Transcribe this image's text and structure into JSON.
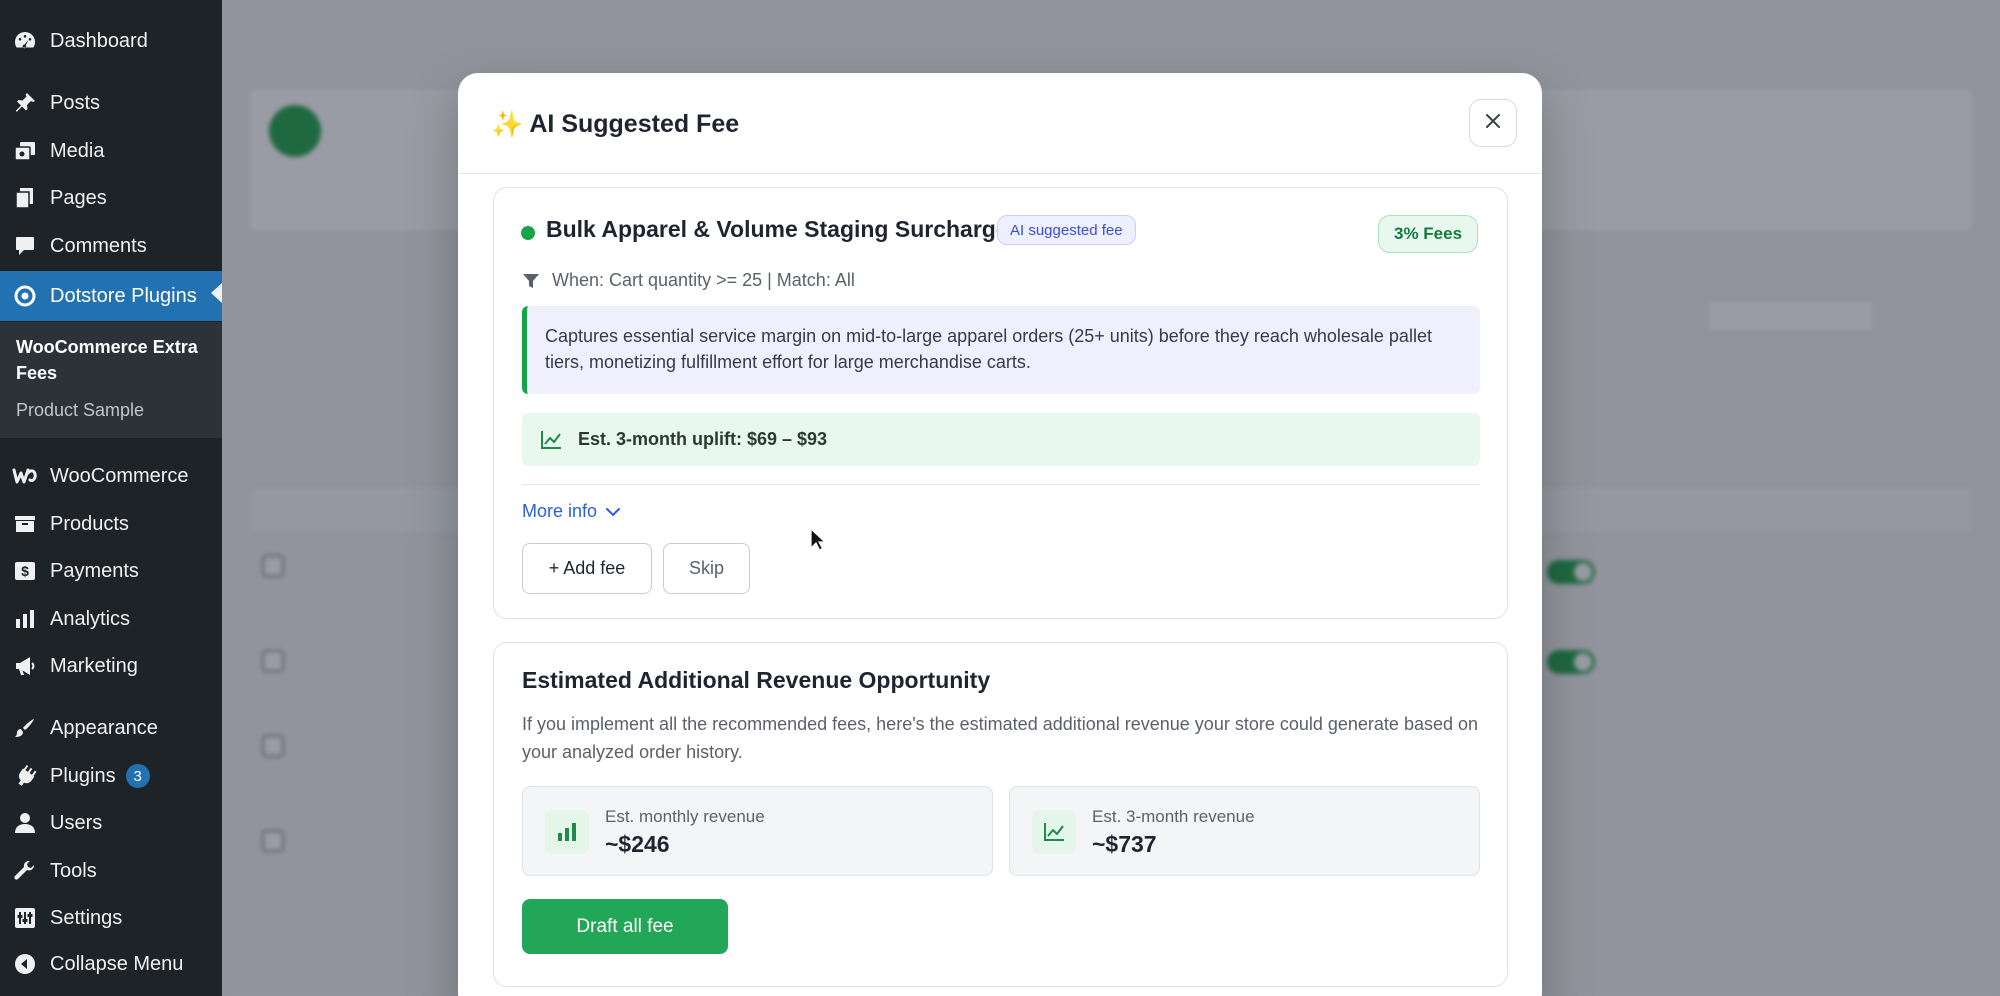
{
  "sidebar": {
    "items": [
      {
        "label": "Dashboard",
        "icon": "dashboard-icon"
      },
      {
        "label": "Posts",
        "icon": "pin-icon"
      },
      {
        "label": "Media",
        "icon": "media-icon"
      },
      {
        "label": "Pages",
        "icon": "pages-icon"
      },
      {
        "label": "Comments",
        "icon": "comment-icon"
      },
      {
        "label": "Dotstore Plugins",
        "icon": "dotstore-icon"
      },
      {
        "label": "WooCommerce",
        "icon": "woo-icon"
      },
      {
        "label": "Products",
        "icon": "products-icon"
      },
      {
        "label": "Payments",
        "icon": "payments-icon"
      },
      {
        "label": "Analytics",
        "icon": "analytics-icon"
      },
      {
        "label": "Marketing",
        "icon": "megaphone-icon"
      },
      {
        "label": "Appearance",
        "icon": "brush-icon"
      },
      {
        "label": "Plugins",
        "icon": "plugin-icon",
        "badge": "3"
      },
      {
        "label": "Users",
        "icon": "user-icon"
      },
      {
        "label": "Tools",
        "icon": "wrench-icon"
      },
      {
        "label": "Settings",
        "icon": "settings-icon"
      },
      {
        "label": "Collapse Menu",
        "icon": "collapse-icon"
      }
    ],
    "submenu": {
      "title": "WooCommerce Extra Fees",
      "item": "Product Sample"
    },
    "active_color": "#2271b1"
  },
  "modal": {
    "title": "AI Suggested Fee",
    "fee": {
      "name": "Bulk Apparel & Volume Staging Surcharge",
      "badge": "AI suggested fee",
      "percent_badge": "3% Fees",
      "condition": "When: Cart quantity >= 25 | Match: All",
      "description": "Captures essential service margin on mid-to-large apparel orders (25+ units) before they reach wholesale pallet tiers, monetizing fulfillment effort for large merchandise carts.",
      "uplift": "Est. 3-month uplift: $69 – $93",
      "more_info": "More info",
      "add_button": "+ Add fee",
      "skip_button": "Skip"
    },
    "revenue": {
      "title": "Estimated Additional Revenue Opportunity",
      "description": "If you implement all the recommended fees, here's the estimated additional revenue your store could generate based on your analyzed order history.",
      "monthly_label": "Est. monthly revenue",
      "monthly_value": "~$246",
      "three_month_label": "Est. 3-month revenue",
      "three_month_value": "~$737",
      "draft_button": "Draft all fee"
    },
    "colors": {
      "accent_green": "#22a657",
      "link_blue": "#2b5fd9",
      "badge_blue": "#3b4fd0"
    }
  }
}
